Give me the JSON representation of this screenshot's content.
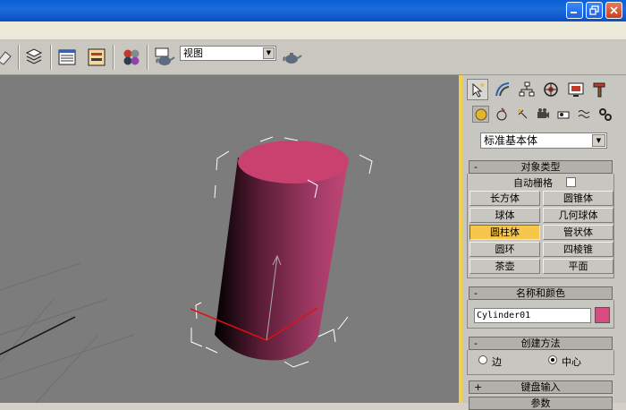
{
  "window": {
    "minimize_icon": "minimize-icon",
    "restore_icon": "restore-icon",
    "close_icon": "close-icon"
  },
  "toolbar": {
    "view_select": {
      "value": "视图"
    }
  },
  "panel": {
    "category_dropdown": {
      "value": "标准基本体"
    },
    "object_type": {
      "header": "对象类型",
      "collapse_symbol": "-",
      "autogrid_label": "自动栅格",
      "autogrid_checked": false,
      "buttons": [
        {
          "label": "长方体",
          "active": false
        },
        {
          "label": "圆锥体",
          "active": false
        },
        {
          "label": "球体",
          "active": false
        },
        {
          "label": "几何球体",
          "active": false
        },
        {
          "label": "圆柱体",
          "active": true
        },
        {
          "label": "管状体",
          "active": false
        },
        {
          "label": "圆环",
          "active": false
        },
        {
          "label": "四棱锥",
          "active": false
        },
        {
          "label": "茶壶",
          "active": false
        },
        {
          "label": "平面",
          "active": false
        }
      ]
    },
    "name_color": {
      "header": "名称和颜色",
      "collapse_symbol": "-",
      "object_name": "Cylinder01",
      "color": "#d44e84"
    },
    "creation_method": {
      "header": "创建方法",
      "collapse_symbol": "-",
      "option_edge": "边",
      "option_center": "中心"
    },
    "keyboard_entry": {
      "header": "键盘输入",
      "collapse_symbol": "+"
    },
    "parameters": {
      "header": "参数"
    }
  },
  "colors": {
    "active_button": "#f5c64b",
    "viewport_border": "#f2d14a",
    "cylinder": "#c9416f",
    "title_bar": "#0a5fd8"
  }
}
